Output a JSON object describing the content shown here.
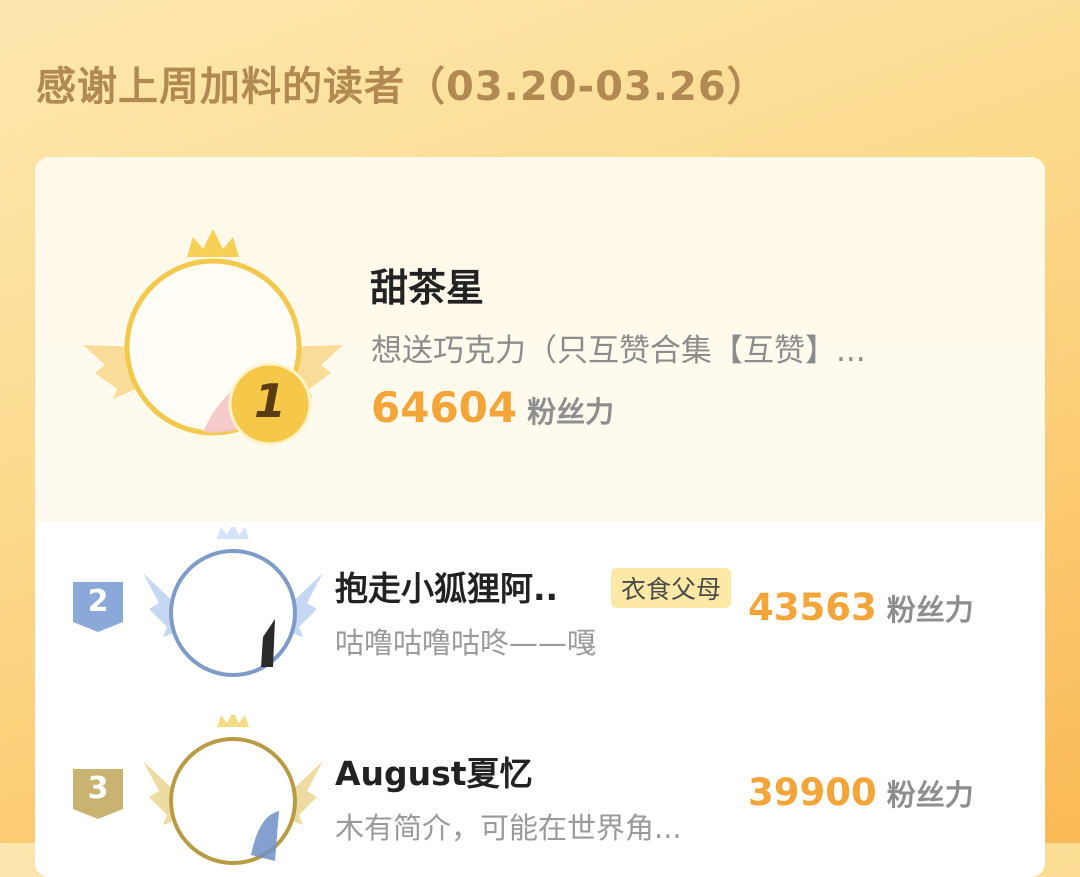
{
  "header": {
    "title": "感谢上周加料的读者（03.20-03.26）"
  },
  "leaderboard": {
    "score_unit": "粉丝力",
    "entries": [
      {
        "rank": "1",
        "name": "甜茶星",
        "bio": "想送巧克力（只互赞合集【互赞】...",
        "score": "64604",
        "tag": ""
      },
      {
        "rank": "2",
        "name": "抱走小狐狸阿..",
        "bio": "咕噜咕噜咕咚——嘎",
        "score": "43563",
        "tag": "衣食父母"
      },
      {
        "rank": "3",
        "name": "August夏忆",
        "bio": "木有简介，可能在世界角...",
        "score": "39900",
        "tag": ""
      }
    ]
  },
  "colors": {
    "gold": "#f2c94c",
    "silver": "#7f9bc7",
    "bronze": "#b89b45",
    "score": "#f3a53a"
  }
}
